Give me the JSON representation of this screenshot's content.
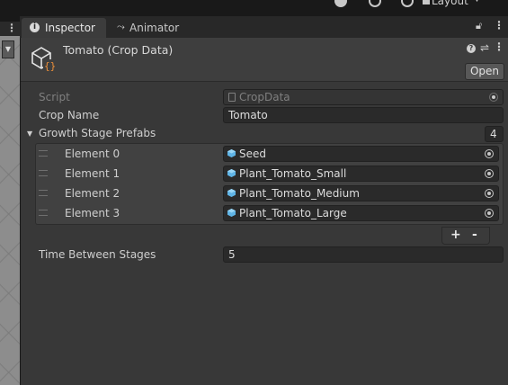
{
  "toolbar": {
    "layout_label": "Layout"
  },
  "tabs": [
    {
      "label": "Inspector",
      "icon": "info-icon",
      "active": true
    },
    {
      "label": "Animator",
      "icon": "animator-icon",
      "active": false
    }
  ],
  "header": {
    "title": "Tomato (Crop Data)",
    "open_label": "Open",
    "icon": "scriptable-object-icon",
    "accent_color": "#4fc3f7"
  },
  "fields": {
    "script": {
      "label": "Script",
      "value": "CropData"
    },
    "crop_name": {
      "label": "Crop Name",
      "value": "Tomato"
    },
    "growth_stage_prefabs": {
      "label": "Growth Stage Prefabs",
      "count": "4",
      "elements": [
        {
          "label": "Element 0",
          "value": "Seed"
        },
        {
          "label": "Element 1",
          "value": "Plant_Tomato_Small"
        },
        {
          "label": "Element 2",
          "value": "Plant_Tomato_Medium"
        },
        {
          "label": "Element 3",
          "value": "Plant_Tomato_Large"
        }
      ],
      "add_label": "+",
      "remove_label": "-"
    },
    "time_between_stages": {
      "label": "Time Between Stages",
      "value": "5"
    }
  }
}
